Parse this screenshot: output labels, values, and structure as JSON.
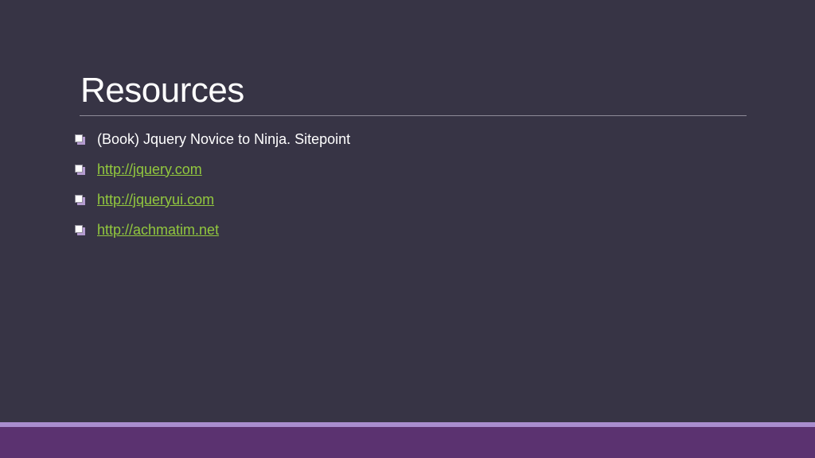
{
  "slide": {
    "title": "Resources",
    "items": [
      {
        "kind": "text",
        "text": "(Book) Jquery Novice to Ninja. Sitepoint",
        "bullet_icon": "square-checkbox-icon"
      },
      {
        "kind": "link",
        "text": "http://jquery.com",
        "bullet_icon": "square-checkbox-icon"
      },
      {
        "kind": "link",
        "text": "http://jqueryui.com",
        "bullet_icon": "square-checkbox-icon"
      },
      {
        "kind": "link",
        "text": "http://achmatim.net",
        "bullet_icon": "square-checkbox-icon"
      }
    ]
  },
  "colors": {
    "background": "#373445",
    "text": "#ffffff",
    "link": "#92c83e",
    "accent_light": "#a98dce",
    "accent_dark": "#5b3270"
  }
}
